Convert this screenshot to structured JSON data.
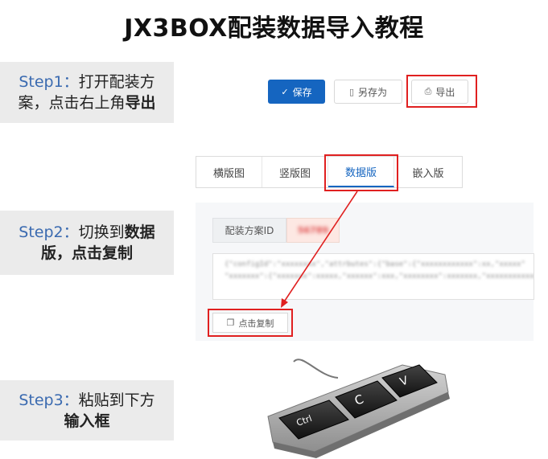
{
  "title": "JX3BOX配装数据导入教程",
  "steps": [
    {
      "num": "Step1：",
      "text": "打开配装方",
      "text2": "案，点击右上角",
      "bold": "导出"
    },
    {
      "num": "Step2：",
      "text": "切换到",
      "bold1": "数据",
      "bold2": "版，点击复制"
    },
    {
      "num": "Step3：",
      "text": "粘贴到下方",
      "bold": "输入框"
    }
  ],
  "toolbar": {
    "save_label": "保存",
    "saveas_label": "另存为",
    "export_label": "导出",
    "save_icon": "check-icon",
    "saveas_icon": "file-icon",
    "export_icon": "printer-icon"
  },
  "tabs": [
    "横版图",
    "竖版图",
    "数据版",
    "嵌入版"
  ],
  "active_tab": "数据版",
  "panel": {
    "field_label": "配装方案ID",
    "id_value": "56789",
    "code_lines": [
      "{\"configId\":\"xxxxxxxx\",\"attrbutes\":{\"base\":{\"xxxxxxxxxxxx\":xx,\"xxxxx\"",
      "\"xxxxxxx\":{\"xxxxxxx\":xxxxx,\"xxxxxx\":xxx,\"xxxxxxxx\":xxxxxxx,\"xxxxxxxxxxxx\""
    ],
    "copy_label": "点击复制",
    "copy_icon": "copy-icon"
  },
  "keyboard": {
    "keys": [
      "Ctrl",
      "C",
      "V"
    ]
  },
  "colors": {
    "accent": "#1565c0",
    "highlight": "#e02020",
    "step_bg": "#ebebeb",
    "step_num": "#3a6ab0"
  }
}
